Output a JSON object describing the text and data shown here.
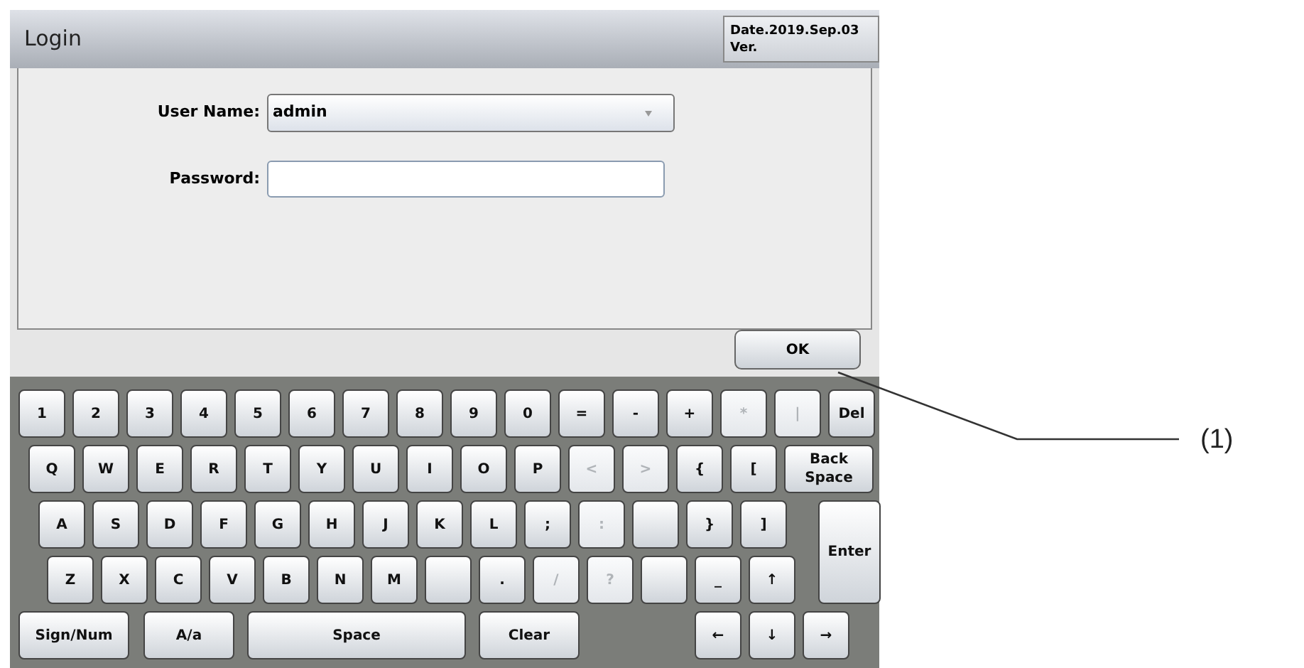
{
  "window": {
    "title": "Login",
    "date": "Date.2019.Sep.03",
    "version": "Ver."
  },
  "form": {
    "fields": [
      {
        "label": "User Name:",
        "kind": "dropdown",
        "value": "admin"
      },
      {
        "label": "Password:",
        "kind": "password"
      }
    ]
  },
  "ok_button": "OK",
  "keyboard": {
    "rows": [
      [
        {
          "kind": "key",
          "label": "1",
          "disabled": false
        },
        {
          "kind": "key",
          "label": "2",
          "disabled": false
        },
        {
          "kind": "key",
          "label": "3",
          "disabled": false
        },
        {
          "kind": "key",
          "label": "4",
          "disabled": false
        },
        {
          "kind": "key",
          "label": "5",
          "disabled": false
        },
        {
          "kind": "key",
          "label": "6",
          "disabled": false
        },
        {
          "kind": "key",
          "label": "7",
          "disabled": false
        },
        {
          "kind": "key",
          "label": "8",
          "disabled": false
        },
        {
          "kind": "key",
          "label": "9",
          "disabled": false
        },
        {
          "kind": "key",
          "label": "0",
          "disabled": false
        },
        {
          "kind": "key",
          "label": "=",
          "disabled": false
        },
        {
          "kind": "key",
          "label": "-",
          "disabled": false
        },
        {
          "kind": "key",
          "label": "+",
          "disabled": false
        },
        {
          "kind": "key",
          "label": "*",
          "disabled": true
        },
        {
          "kind": "key",
          "label": "|",
          "disabled": true
        },
        {
          "kind": "key",
          "label": "Del",
          "disabled": false
        }
      ],
      [
        {
          "kind": "key",
          "label": "Q",
          "disabled": false
        },
        {
          "kind": "key",
          "label": "W",
          "disabled": false
        },
        {
          "kind": "key",
          "label": "E",
          "disabled": false
        },
        {
          "kind": "key",
          "label": "R",
          "disabled": false
        },
        {
          "kind": "key",
          "label": "T",
          "disabled": false
        },
        {
          "kind": "key",
          "label": "Y",
          "disabled": false
        },
        {
          "kind": "key",
          "label": "U",
          "disabled": false
        },
        {
          "kind": "key",
          "label": "I",
          "disabled": false
        },
        {
          "kind": "key",
          "label": "O",
          "disabled": false
        },
        {
          "kind": "key",
          "label": "P",
          "disabled": false
        },
        {
          "kind": "key",
          "label": "<",
          "disabled": true
        },
        {
          "kind": "key",
          "label": ">",
          "disabled": true
        },
        {
          "kind": "key",
          "label": "{",
          "disabled": false
        },
        {
          "kind": "key",
          "label": "[",
          "disabled": false
        },
        {
          "kind": "backspace",
          "label": "Back Space",
          "disabled": false
        }
      ],
      [
        {
          "kind": "key",
          "label": "A",
          "disabled": false
        },
        {
          "kind": "key",
          "label": "S",
          "disabled": false
        },
        {
          "kind": "key",
          "label": "D",
          "disabled": false
        },
        {
          "kind": "key",
          "label": "F",
          "disabled": false
        },
        {
          "kind": "key",
          "label": "G",
          "disabled": false
        },
        {
          "kind": "key",
          "label": "H",
          "disabled": false
        },
        {
          "kind": "key",
          "label": "J",
          "disabled": false
        },
        {
          "kind": "key",
          "label": "K",
          "disabled": false
        },
        {
          "kind": "key",
          "label": "L",
          "disabled": false
        },
        {
          "kind": "key",
          "label": ";",
          "disabled": false
        },
        {
          "kind": "key",
          "label": ":",
          "disabled": true
        },
        {
          "kind": "blank",
          "disabled": false
        },
        {
          "kind": "key",
          "label": "}",
          "disabled": false
        },
        {
          "kind": "key",
          "label": "]",
          "disabled": false
        },
        {
          "kind": "enter",
          "label": "Enter",
          "disabled": false
        }
      ],
      [
        {
          "kind": "key",
          "label": "Z",
          "disabled": false
        },
        {
          "kind": "key",
          "label": "X",
          "disabled": false
        },
        {
          "kind": "key",
          "label": "C",
          "disabled": false
        },
        {
          "kind": "key",
          "label": "V",
          "disabled": false
        },
        {
          "kind": "key",
          "label": "B",
          "disabled": false
        },
        {
          "kind": "key",
          "label": "N",
          "disabled": false
        },
        {
          "kind": "key",
          "label": "M",
          "disabled": false
        },
        {
          "kind": "blank",
          "disabled": false
        },
        {
          "kind": "key",
          "label": ".",
          "disabled": false
        },
        {
          "kind": "key",
          "label": "/",
          "disabled": true
        },
        {
          "kind": "key",
          "label": "?",
          "disabled": true
        },
        {
          "kind": "blank",
          "disabled": false
        },
        {
          "kind": "key",
          "label": "_",
          "disabled": false
        },
        {
          "kind": "key",
          "label": "↑",
          "disabled": false
        }
      ]
    ],
    "bottom_row": [
      {
        "kind": "sign",
        "label": "Sign/Num",
        "disabled": false
      },
      {
        "kind": "case",
        "label": "A/a",
        "disabled": false
      },
      {
        "kind": "space",
        "label": "Space",
        "disabled": false
      },
      {
        "kind": "clear",
        "label": "Clear",
        "disabled": false
      },
      {
        "kind": "arrow",
        "label": "←",
        "disabled": false
      },
      {
        "kind": "arrow",
        "label": "↓",
        "disabled": false
      },
      {
        "kind": "arrow",
        "label": "→",
        "disabled": false
      }
    ]
  },
  "callout": {
    "label": "(1)"
  }
}
